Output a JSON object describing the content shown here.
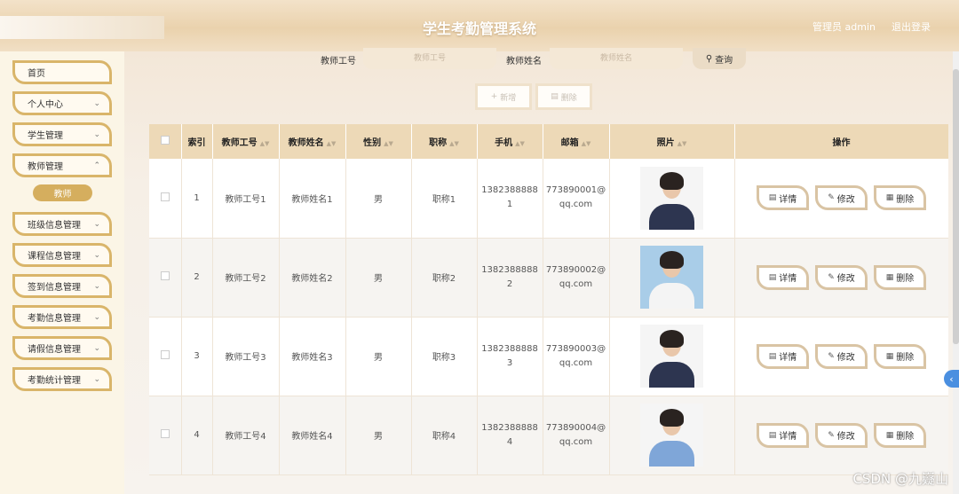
{
  "header": {
    "title": "学生考勤管理系统",
    "user": "管理员 admin",
    "logout": "退出登录"
  },
  "sidebar": {
    "items": [
      {
        "label": "首页"
      },
      {
        "label": "个人中心"
      },
      {
        "label": "学生管理"
      },
      {
        "label": "教师管理"
      },
      {
        "label": "班级信息管理"
      },
      {
        "label": "课程信息管理"
      },
      {
        "label": "签到信息管理"
      },
      {
        "label": "考勤信息管理"
      },
      {
        "label": "请假信息管理"
      },
      {
        "label": "考勤统计管理"
      }
    ],
    "sub_item": "教师"
  },
  "search": {
    "teacher_id_label": "教师工号",
    "teacher_id_placeholder": "教师工号",
    "teacher_name_label": "教师姓名",
    "teacher_name_placeholder": "教师姓名",
    "query_label": "查询"
  },
  "actions": {
    "add_label": "新增",
    "delete_label": "删除"
  },
  "table": {
    "headers": {
      "index": "索引",
      "teacher_id": "教师工号",
      "teacher_name": "教师姓名",
      "gender": "性别",
      "title": "职称",
      "phone": "手机",
      "email": "邮箱",
      "photo": "照片",
      "ops": "操作"
    },
    "rows": [
      {
        "index": "1",
        "teacher_id": "教师工号1",
        "teacher_name": "教师姓名1",
        "gender": "男",
        "title": "职称1",
        "phone_a": "1382388888",
        "phone_b": "1",
        "email_a": "773890001@",
        "email_b": "qq.com"
      },
      {
        "index": "2",
        "teacher_id": "教师工号2",
        "teacher_name": "教师姓名2",
        "gender": "男",
        "title": "职称2",
        "phone_a": "1382388888",
        "phone_b": "2",
        "email_a": "773890002@",
        "email_b": "qq.com"
      },
      {
        "index": "3",
        "teacher_id": "教师工号3",
        "teacher_name": "教师姓名3",
        "gender": "男",
        "title": "职称3",
        "phone_a": "1382388888",
        "phone_b": "3",
        "email_a": "773890003@",
        "email_b": "qq.com"
      },
      {
        "index": "4",
        "teacher_id": "教师工号4",
        "teacher_name": "教师姓名4",
        "gender": "男",
        "title": "职称4",
        "phone_a": "1382388888",
        "phone_b": "4",
        "email_a": "773890004@",
        "email_b": "qq.com"
      }
    ],
    "op_labels": {
      "detail": "详情",
      "edit": "修改",
      "delete": "删除"
    }
  },
  "watermark": "CSDN @九嶷山"
}
